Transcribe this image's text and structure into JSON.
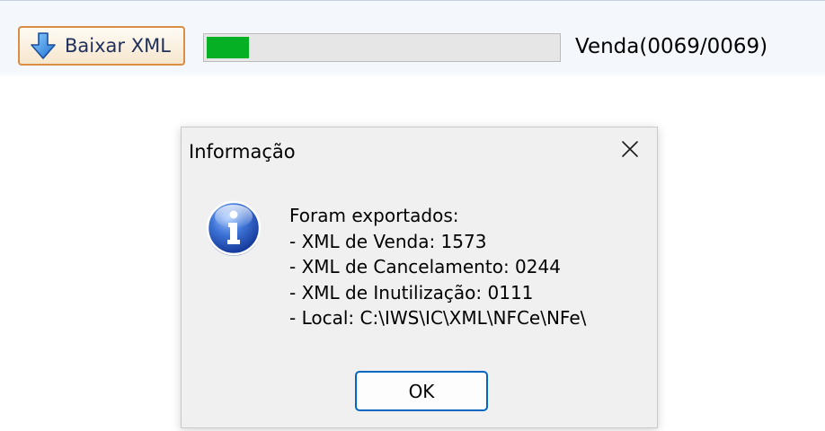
{
  "toolbar": {
    "download_button_label": "Baixar XML",
    "download_icon": "arrow-down-icon",
    "progress_fraction": 0.12,
    "progress_status": "Venda(0069/0069)",
    "progress_color": "#06b025"
  },
  "dialog": {
    "title": "Informação",
    "close_icon": "close-icon",
    "icon": "info-icon",
    "message_lines": [
      "Foram exportados:",
      "- XML de Venda: 1573",
      "- XML de Cancelamento: 0244",
      "- XML de Inutilização: 0111",
      "- Local: C:\\IWS\\IC\\XML\\NFCe\\NFe\\"
    ],
    "ok_label": "OK",
    "ok_border_color": "#0067c0"
  }
}
